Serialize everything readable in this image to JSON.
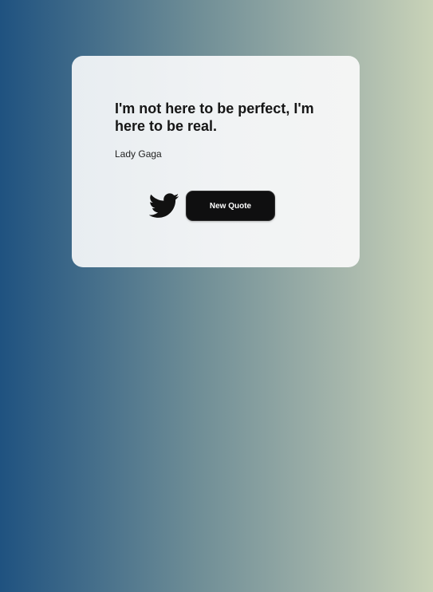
{
  "quote": {
    "text": "I'm not here to be perfect, I'm here to be real.",
    "author": "Lady Gaga"
  },
  "actions": {
    "tweet_icon": "twitter-bird-icon",
    "new_quote_label": "New Quote"
  },
  "colors": {
    "gradient_start": "#1f5280",
    "gradient_end": "#c9d3b8",
    "card": "#eef1f3",
    "button": "#0f0f10",
    "button_text": "#ffffff",
    "icon": "#111111"
  }
}
